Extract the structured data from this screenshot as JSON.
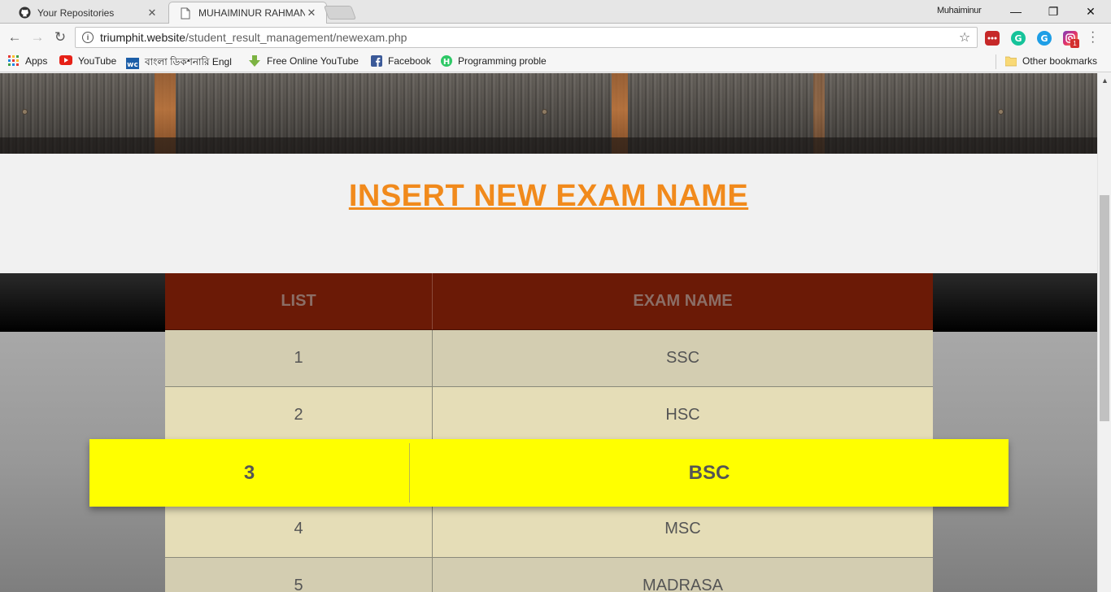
{
  "browser": {
    "tabs": [
      {
        "title": "Your Repositories",
        "icon": "github-icon"
      },
      {
        "title": "MUHAIMINUR RAHMAN",
        "icon": "page-icon"
      }
    ],
    "profile_name": "Muhaiminur",
    "url_host": "triumphit.website",
    "url_path": "/student_result_management/newexam.php",
    "bookmarks": [
      {
        "label": "Apps",
        "icon": "apps-grid-icon"
      },
      {
        "label": "YouTube",
        "icon": "youtube-icon"
      },
      {
        "label": "বাংলা ডিকশনারি Engl",
        "icon": "wc-icon"
      },
      {
        "label": "Free Online YouTube",
        "icon": "download-arrow-icon"
      },
      {
        "label": "Facebook",
        "icon": "facebook-icon"
      },
      {
        "label": "Programming proble",
        "icon": "hackerrank-icon"
      }
    ],
    "other_bookmarks": "Other bookmarks",
    "extension_badge": "1"
  },
  "page": {
    "heading": "INSERT NEW EXAM NAME",
    "table": {
      "headers": [
        "LIST",
        "EXAM NAME"
      ],
      "rows": [
        {
          "list": "1",
          "name": "SSC"
        },
        {
          "list": "2",
          "name": "HSC"
        },
        {
          "list": "3",
          "name": "BSC"
        },
        {
          "list": "4",
          "name": "MSC"
        },
        {
          "list": "5",
          "name": "MADRASA"
        }
      ],
      "highlighted_row_index": 2
    }
  },
  "colors": {
    "heading": "#f18a1c",
    "table_header_bg": "#6b1a06",
    "row_odd_bg": "#d3cdb1",
    "row_even_bg": "#e5ddb7",
    "highlight_bg": "#ffff00"
  }
}
